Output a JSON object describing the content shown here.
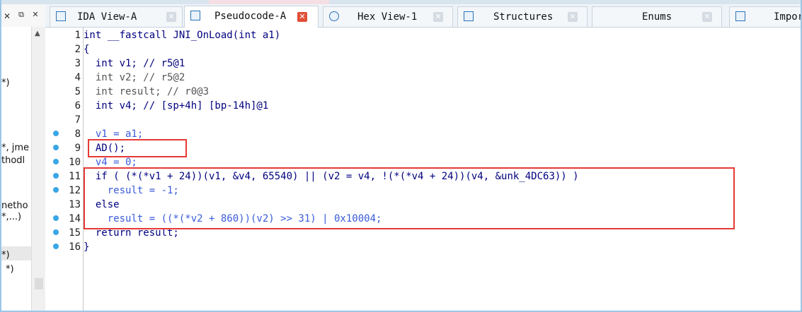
{
  "left_pane": {
    "close_glyph": "✕",
    "float_glyph": "⧉",
    "close2_glyph": "✕",
    "fragments": [
      "*)",
      "*, jme",
      "thodl",
      "netho",
      "*,...)",
      "*)",
      "*)"
    ]
  },
  "tabs": [
    {
      "label": "IDA View-A",
      "icon": "ida-view-icon",
      "active": false
    },
    {
      "label": "Pseudocode-A",
      "icon": "pseudocode-icon",
      "active": true
    },
    {
      "label": "Hex View-1",
      "icon": "hex-view-icon",
      "active": false
    },
    {
      "label": "Structures",
      "icon": "structures-icon",
      "active": false
    },
    {
      "label": "Enums",
      "icon": "enums-icon",
      "active": false
    },
    {
      "label": "Impor",
      "icon": "imports-icon",
      "active": false
    }
  ],
  "close_glyph": "✕",
  "colors": {
    "keyword": "#00007f",
    "variable": "#3a5bd8",
    "highlight": "#e53935",
    "breakpoint_dot": "#3aa6e6"
  },
  "code": {
    "line_numbers": [
      "1",
      "2",
      "3",
      "4",
      "5",
      "6",
      "7",
      "8",
      "9",
      "10",
      "11",
      "12",
      "13",
      "14",
      "15",
      "16"
    ],
    "lines": [
      "int __fastcall JNI_OnLoad(int a1)",
      "{",
      "  int v1; // r5@1",
      "  int v2; // r5@2",
      "  int result; // r0@3",
      "  int v4; // [sp+4h] [bp-14h]@1",
      "",
      "  v1 = a1;",
      "  AD();",
      "  v4 = 0;",
      "  if ( (*(*v1 + 24))(v1, &v4, 65540) || (v2 = v4, !(*(*v4 + 24))(v4, &unk_4DC63)) )",
      "    result = -1;",
      "  else",
      "    result = ((*(*v2 + 860))(v2) >> 31) | 0x10004;",
      "  return result;",
      "}"
    ]
  }
}
